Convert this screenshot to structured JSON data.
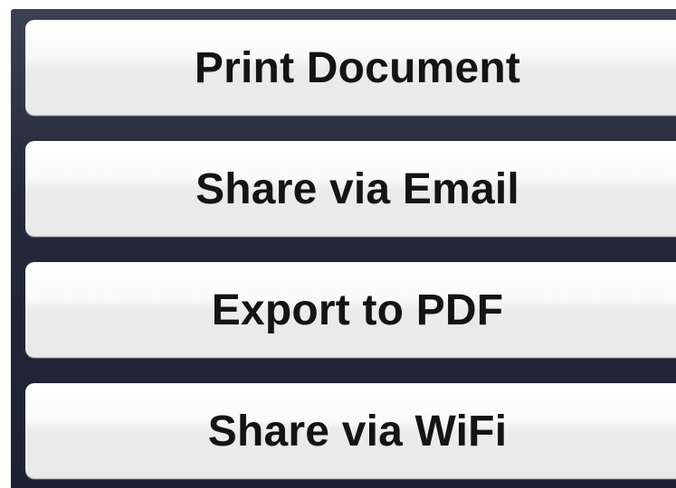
{
  "action_sheet": {
    "buttons": [
      {
        "label": "Print Document"
      },
      {
        "label": "Share via Email"
      },
      {
        "label": "Export to PDF"
      },
      {
        "label": "Share via WiFi"
      }
    ]
  },
  "colors": {
    "sheet_background": "#232938",
    "button_background": "#f4f4f4",
    "button_text": "#141414"
  }
}
